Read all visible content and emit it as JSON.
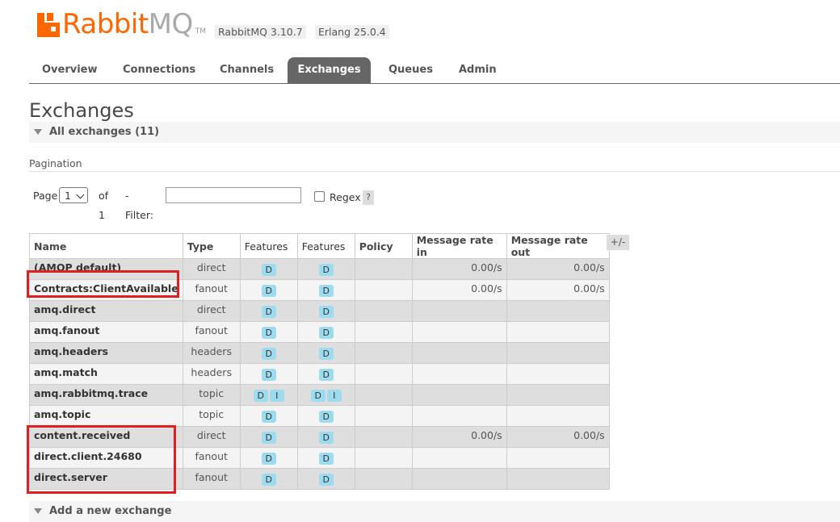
{
  "header": {
    "logo_rabbit": "Rabbit",
    "logo_mq": "MQ",
    "logo_tm": "TM",
    "rabbitmq_version": "RabbitMQ 3.10.7",
    "erlang_version": "Erlang 25.0.4"
  },
  "tabs": [
    {
      "label": "Overview",
      "active": false
    },
    {
      "label": "Connections",
      "active": false
    },
    {
      "label": "Channels",
      "active": false
    },
    {
      "label": "Exchanges",
      "active": true
    },
    {
      "label": "Queues",
      "active": false
    },
    {
      "label": "Admin",
      "active": false
    }
  ],
  "page_title": "Exchanges",
  "all_exchanges_label": "All exchanges (11)",
  "pagination": {
    "section_label": "Pagination",
    "page_label": "Page",
    "page_value": "1",
    "of_label": "of 1",
    "filter_label": "- Filter:",
    "filter_value": "",
    "regex_label": "Regex",
    "regex_checked": false,
    "help_label": "?"
  },
  "table": {
    "headers": [
      "Name",
      "Type",
      "Features",
      "Features",
      "Policy",
      "Message rate in",
      "Message rate out"
    ],
    "toggle_label": "+/-",
    "rows": [
      {
        "name": "(AMQP default)",
        "type": "direct",
        "f1": [
          "D"
        ],
        "f2": [
          "D"
        ],
        "policy": "",
        "rate_in": "0.00/s",
        "rate_out": "0.00/s"
      },
      {
        "name": "Contracts:ClientAvailable",
        "type": "fanout",
        "f1": [
          "D"
        ],
        "f2": [
          "D"
        ],
        "policy": "",
        "rate_in": "0.00/s",
        "rate_out": "0.00/s"
      },
      {
        "name": "amq.direct",
        "type": "direct",
        "f1": [
          "D"
        ],
        "f2": [
          "D"
        ],
        "policy": "",
        "rate_in": "",
        "rate_out": ""
      },
      {
        "name": "amq.fanout",
        "type": "fanout",
        "f1": [
          "D"
        ],
        "f2": [
          "D"
        ],
        "policy": "",
        "rate_in": "",
        "rate_out": ""
      },
      {
        "name": "amq.headers",
        "type": "headers",
        "f1": [
          "D"
        ],
        "f2": [
          "D"
        ],
        "policy": "",
        "rate_in": "",
        "rate_out": ""
      },
      {
        "name": "amq.match",
        "type": "headers",
        "f1": [
          "D"
        ],
        "f2": [
          "D"
        ],
        "policy": "",
        "rate_in": "",
        "rate_out": ""
      },
      {
        "name": "amq.rabbitmq.trace",
        "type": "topic",
        "f1": [
          "D",
          "I"
        ],
        "f2": [
          "D",
          "I"
        ],
        "policy": "",
        "rate_in": "",
        "rate_out": ""
      },
      {
        "name": "amq.topic",
        "type": "topic",
        "f1": [
          "D"
        ],
        "f2": [
          "D"
        ],
        "policy": "",
        "rate_in": "",
        "rate_out": ""
      },
      {
        "name": "content.received",
        "type": "direct",
        "f1": [
          "D"
        ],
        "f2": [
          "D"
        ],
        "policy": "",
        "rate_in": "0.00/s",
        "rate_out": "0.00/s"
      },
      {
        "name": "direct.client.24680",
        "type": "fanout",
        "f1": [
          "D"
        ],
        "f2": [
          "D"
        ],
        "policy": "",
        "rate_in": "",
        "rate_out": ""
      },
      {
        "name": "direct.server",
        "type": "fanout",
        "f1": [
          "D"
        ],
        "f2": [
          "D"
        ],
        "policy": "",
        "rate_in": "",
        "rate_out": ""
      }
    ]
  },
  "add_exchange_label": "Add a new exchange",
  "colors": {
    "brand": "#ff6600",
    "active_tab": "#666666",
    "feature_badge": "#9ddcef",
    "highlight_box": "#e02020"
  }
}
